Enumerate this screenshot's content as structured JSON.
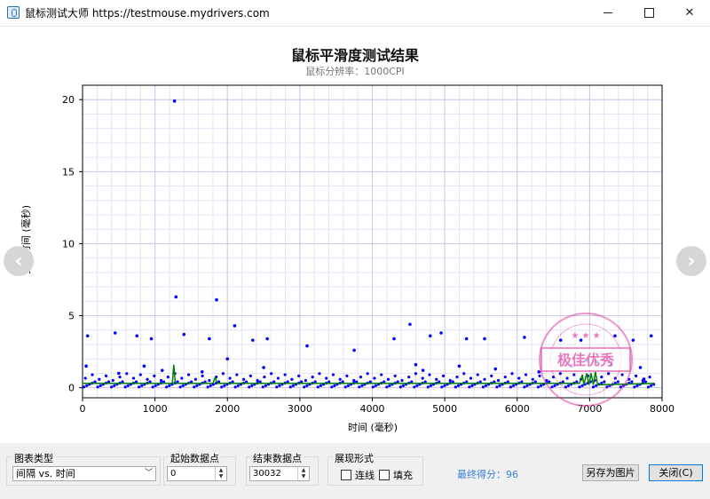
{
  "window": {
    "title": "鼠标测试大师 https://testmouse.mydrivers.com"
  },
  "chart_data": {
    "type": "scatter",
    "title": "鼠标平滑度测试结果",
    "subtitle": "鼠标分辨率：1000CPI",
    "xlabel": "时间 (毫秒)",
    "ylabel": "更新时间 (毫秒)",
    "xlim": [
      0,
      8000
    ],
    "ylim": [
      -0.7,
      21
    ],
    "xticks": [
      0,
      1000,
      2000,
      3000,
      4000,
      5000,
      6000,
      7000,
      8000
    ],
    "yticks": [
      0,
      5,
      10,
      15,
      20
    ],
    "x_tick_labels": [
      "0",
      "1000",
      "2000",
      "3000",
      "4000",
      "5000",
      "6000",
      "7000",
      "8000"
    ],
    "y_tick_labels": [
      "0",
      "5",
      "10",
      "15",
      "20"
    ],
    "grid": true,
    "series": [
      {
        "color": "#0000ff",
        "points": [
          [
            1270,
            19.9
          ],
          [
            1290,
            6.3
          ],
          [
            1850,
            6.1
          ],
          [
            2100,
            4.3
          ],
          [
            4520,
            4.4
          ],
          [
            4950,
            3.8
          ],
          [
            3100,
            2.9
          ],
          [
            3750,
            2.6
          ],
          [
            450,
            3.8
          ],
          [
            70,
            3.6
          ],
          [
            750,
            3.6
          ],
          [
            950,
            3.4
          ],
          [
            1400,
            3.7
          ],
          [
            1750,
            3.4
          ],
          [
            2350,
            3.3
          ],
          [
            2550,
            3.4
          ],
          [
            4300,
            3.4
          ],
          [
            4800,
            3.6
          ],
          [
            5300,
            3.4
          ],
          [
            5550,
            3.4
          ],
          [
            6100,
            3.5
          ],
          [
            7350,
            3.6
          ],
          [
            7850,
            3.6
          ],
          [
            6600,
            3.3
          ],
          [
            6880,
            3.3
          ],
          [
            7600,
            3.3
          ],
          [
            50,
            1.5
          ],
          [
            500,
            1.0
          ],
          [
            850,
            1.5
          ],
          [
            1100,
            1.2
          ],
          [
            1650,
            1.1
          ],
          [
            2000,
            2.0
          ],
          [
            2500,
            1.4
          ],
          [
            4600,
            1.6
          ],
          [
            4700,
            1.2
          ],
          [
            5200,
            1.5
          ],
          [
            5700,
            1.3
          ],
          [
            6300,
            1.1
          ],
          [
            6750,
            1.5
          ],
          [
            6950,
            1.9
          ],
          [
            7100,
            1.8
          ],
          [
            7300,
            1.6
          ],
          [
            7700,
            1.4
          ],
          [
            7750,
            0.6
          ]
        ]
      },
      {
        "color": "#008000",
        "line": true,
        "points": [
          [
            0,
            0.3
          ],
          [
            1240,
            0.3
          ],
          [
            1260,
            1.6
          ],
          [
            1280,
            0.3
          ],
          [
            1800,
            0.3
          ],
          [
            1830,
            0.7
          ],
          [
            1860,
            0.3
          ],
          [
            6860,
            0.3
          ],
          [
            6900,
            0.9
          ],
          [
            6920,
            0.2
          ],
          [
            6960,
            1.0
          ],
          [
            6990,
            0.2
          ],
          [
            7020,
            1.0
          ],
          [
            7050,
            0.2
          ],
          [
            7080,
            1.1
          ],
          [
            7110,
            0.2
          ],
          [
            7900,
            0.3
          ]
        ]
      }
    ]
  },
  "nav": {
    "prev_icon": "chevron-left-icon",
    "next_icon": "chevron-right-icon",
    "prev_glyph": "‹",
    "next_glyph": "›"
  },
  "stamp": {
    "text": "极佳优秀",
    "color": "#e040a0"
  },
  "controls": {
    "chart_type": {
      "legend": "图表类型",
      "value": "间隔 vs. 时间",
      "arrow": "﹀"
    },
    "start_point": {
      "legend": "起始数据点",
      "value": "0"
    },
    "end_point": {
      "legend": "结束数据点",
      "value": "30032"
    },
    "display": {
      "legend": "展现形式",
      "line_label": "连线",
      "fill_label": "填充"
    },
    "score": "最终得分：96",
    "save_button": "另存为图片",
    "close_button": "关闭(C)"
  },
  "window_buttons": {
    "minimize": "",
    "maximize": "",
    "close": "✕"
  }
}
